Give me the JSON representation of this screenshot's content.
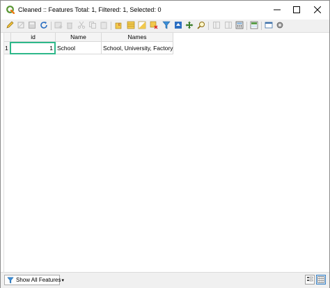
{
  "window": {
    "title": "Cleaned :: Features Total: 1, Filtered: 1, Selected: 0",
    "controls": [
      "minimize-icon",
      "maximize-icon",
      "close-icon"
    ]
  },
  "toolbar": {
    "buttons": [
      {
        "icon": "pencil-edit-icon",
        "enabled": true
      },
      {
        "icon": "multi-edit-icon",
        "enabled": false
      },
      {
        "icon": "save-icon",
        "enabled": false
      },
      {
        "icon": "reload-icon",
        "enabled": true
      },
      {
        "icon": "add-feature-icon",
        "enabled": false
      },
      {
        "icon": "delete-icon",
        "enabled": false
      },
      {
        "icon": "cut-icon",
        "enabled": false
      },
      {
        "icon": "copy-icon",
        "enabled": false
      },
      {
        "icon": "paste-icon",
        "enabled": false
      },
      {
        "icon": "select-by-expression-icon",
        "enabled": true
      },
      {
        "icon": "select-all-icon",
        "enabled": true
      },
      {
        "icon": "invert-selection-icon",
        "enabled": true
      },
      {
        "icon": "deselect-all-icon",
        "enabled": true
      },
      {
        "icon": "filter-icon",
        "enabled": true
      },
      {
        "icon": "move-selection-to-top-icon",
        "enabled": true
      },
      {
        "icon": "pan-to-selection-icon",
        "enabled": true
      },
      {
        "icon": "zoom-to-selection-icon",
        "enabled": true
      },
      {
        "icon": "new-field-icon",
        "enabled": false
      },
      {
        "icon": "delete-field-icon",
        "enabled": false
      },
      {
        "icon": "field-calculator-icon",
        "enabled": true
      },
      {
        "icon": "conditional-formatting-icon",
        "enabled": true
      },
      {
        "icon": "dock-icon",
        "enabled": true
      },
      {
        "icon": "actions-icon",
        "enabled": true
      }
    ]
  },
  "table": {
    "columns": [
      "id",
      "Name",
      "Names"
    ],
    "rows": [
      {
        "row_header": "1",
        "cells": [
          "1",
          "School",
          "School, University, Factory"
        ]
      }
    ]
  },
  "statusbar": {
    "filter_label": "Show All Features",
    "view_buttons": [
      "form-view-icon",
      "table-view-icon"
    ]
  },
  "colors": {
    "selection_border": "#2eb88a",
    "qgis_green": "#589632",
    "toolbar_bg": "#f0f0f0"
  }
}
